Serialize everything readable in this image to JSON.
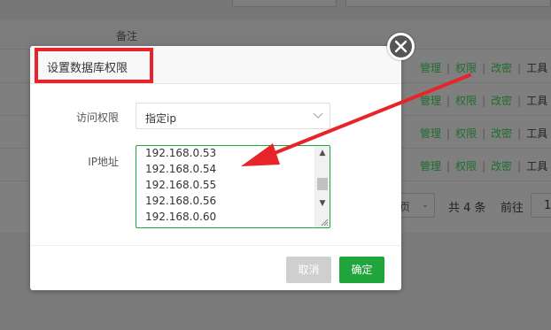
{
  "background": {
    "header_col_remark": "备注",
    "rows": [
      {
        "actions": [
          "管理",
          "权限",
          "改密",
          "工具"
        ]
      },
      {
        "actions": [
          "管理",
          "权限",
          "改密",
          "工具"
        ]
      },
      {
        "actions": [
          "管理",
          "权限",
          "改密",
          "工具"
        ]
      },
      {
        "actions": [
          "管理",
          "权限",
          "改密",
          "工具"
        ]
      }
    ],
    "pager": {
      "page_size_tail": "页",
      "total": "共 4 条",
      "prev": "前往",
      "page_input": "1"
    }
  },
  "dialog": {
    "title": "设置数据库权限",
    "access_label": "访问权限",
    "access_value": "指定ip",
    "ip_label": "IP地址",
    "ip_lines": [
      "192.168.0.53",
      "192.168.0.54",
      "192.168.0.55",
      "192.168.0.56",
      "192.168.0.60"
    ],
    "cancel_label": "取消",
    "ok_label": "确定"
  },
  "colors": {
    "accent": "#20a53a",
    "highlight": "#e8242b"
  },
  "icons": [
    "close-icon",
    "chevron-down-icon",
    "scroll-up-icon",
    "scroll-down-icon",
    "resize-grip-icon",
    "annotation-arrow"
  ]
}
